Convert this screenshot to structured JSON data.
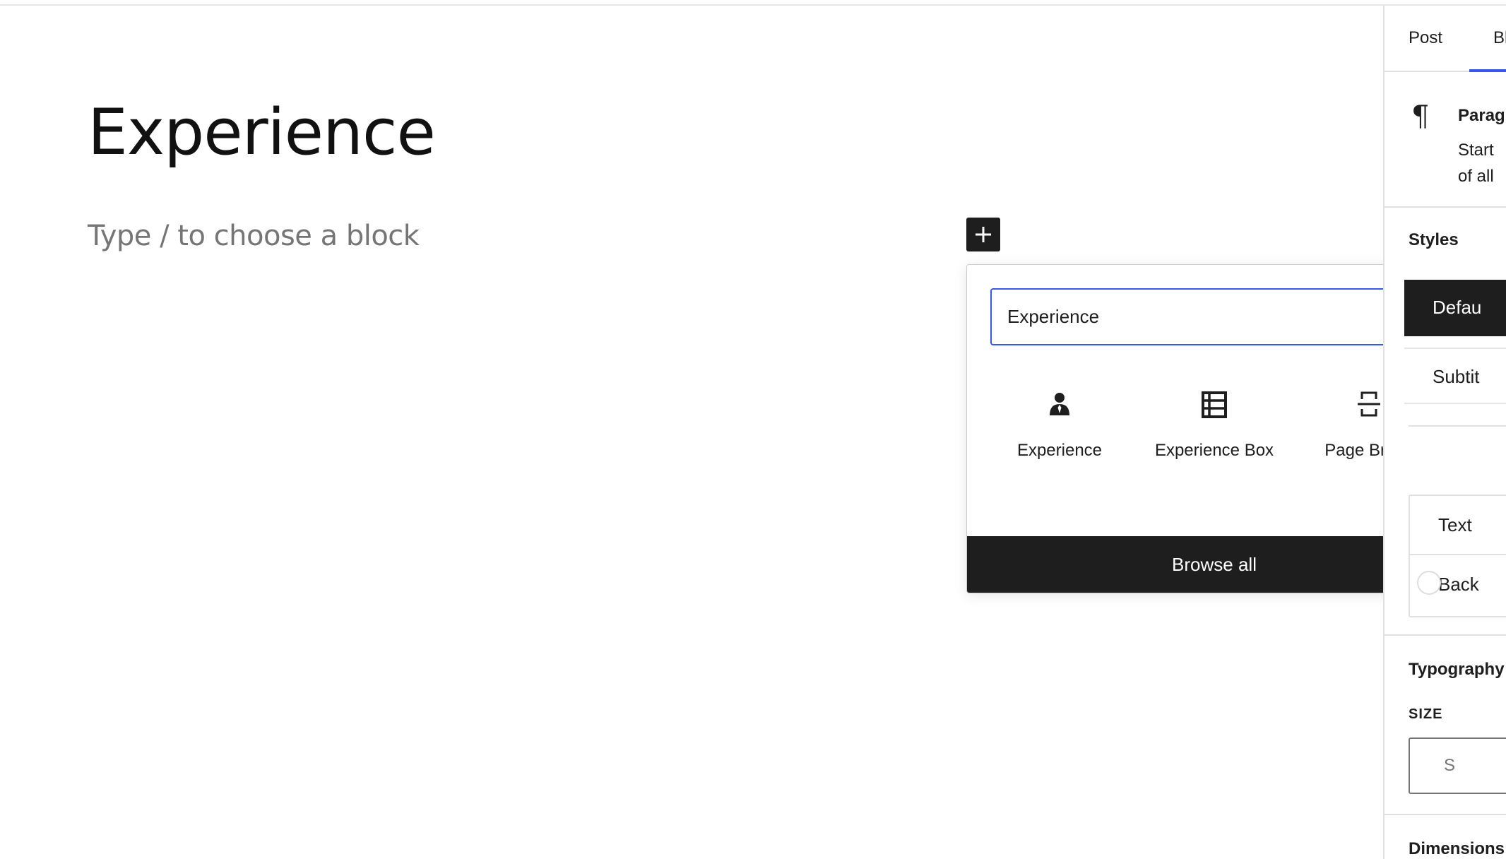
{
  "editor": {
    "post_title": "Experience",
    "block_placeholder": "Type / to choose a block"
  },
  "quick_inserter": {
    "search_value": "Experience",
    "results": [
      {
        "label": "Experience",
        "icon": "person-icon"
      },
      {
        "label": "Experience Box",
        "icon": "layout-icon"
      },
      {
        "label": "Page Break",
        "icon": "page-break-icon"
      }
    ],
    "browse_all_label": "Browse all"
  },
  "sidebar": {
    "tabs": [
      "Post",
      "Bl"
    ],
    "block_card": {
      "title": "Parag",
      "description_line1": "Start",
      "description_line2": "of all"
    },
    "styles": {
      "heading": "Styles",
      "options": [
        "Defau",
        "Subtit"
      ]
    },
    "color": {
      "text_label": "Text",
      "background_label": "Back"
    },
    "typography": {
      "heading": "Typography",
      "size_label": "SIZE",
      "size_value": "S"
    },
    "dimensions": {
      "heading": "Dimensions"
    }
  },
  "colors": {
    "accent": "#3858e9",
    "dark": "#1e1e1e",
    "border": "#e0e0e0"
  }
}
